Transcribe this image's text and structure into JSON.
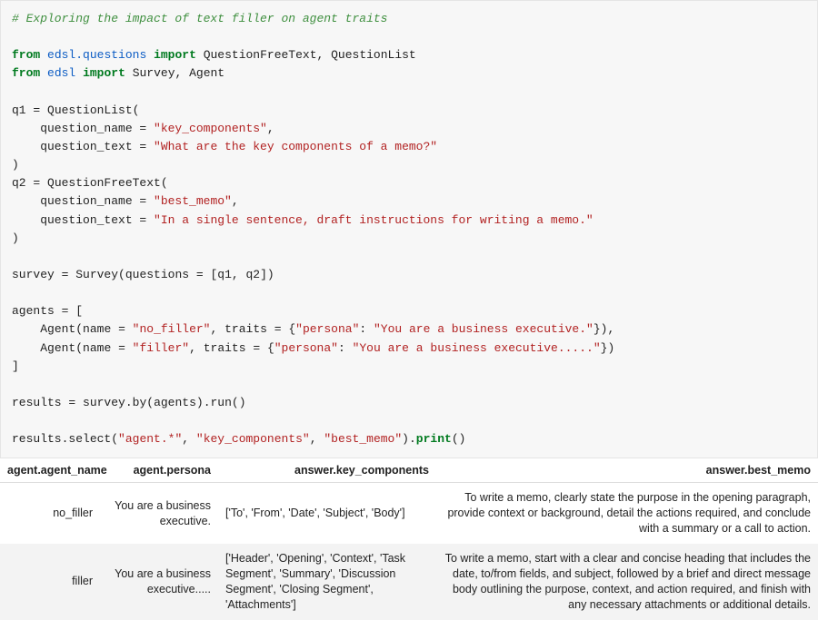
{
  "code": {
    "comment": "# Exploring the impact of text filler on agent traits",
    "kw_from": "from",
    "kw_import": "import",
    "mod1": "edsl.questions",
    "imp1": "QuestionFreeText, QuestionList",
    "mod2": "edsl",
    "imp2": "Survey, Agent",
    "q1_var": "q1",
    "eq": " = ",
    "QList": "QuestionList",
    "QFree": "QuestionFreeText",
    "qname_lbl": "    question_name",
    "qtext_lbl": "    question_text",
    "q1_name": "\"key_components\"",
    "q1_text": "\"What are the key components of a memo?\"",
    "q2_var": "q2",
    "q2_name": "\"best_memo\"",
    "q2_text": "\"In a single sentence, draft instructions for writing a memo.\"",
    "survey_var": "survey",
    "Survey": "Survey",
    "questions_kw": "questions",
    "q_list": "[q1, q2]",
    "agents_var": "agents",
    "open_bracket": " = [",
    "Agent": "Agent",
    "name_kw": "name",
    "traits_kw": "traits",
    "persona_key": "\"persona\"",
    "a1_name": "\"no_filler\"",
    "a1_persona": "\"You are a business executive.\"",
    "a2_name": "\"filler\"",
    "a2_persona": "\"You are a business executive.....\"",
    "close_bracket": "]",
    "results_var": "results",
    "by": "by",
    "run": "run",
    "select": "select",
    "print": "print",
    "sel1": "\"agent.*\"",
    "sel2": "\"key_components\"",
    "sel3": "\"best_memo\"",
    "comma": ",",
    "dot": ".",
    "lp": "(",
    "rp": ")",
    "lb": "{",
    "rb": "}",
    "colon": ": "
  },
  "table": {
    "headers": {
      "agent_name": "agent.agent_name",
      "persona": "agent.persona",
      "key_components": "answer.key_components",
      "best_memo": "answer.best_memo"
    },
    "rows": [
      {
        "name": "no_filler",
        "persona": "You are a business executive.",
        "key_components": "['To', 'From', 'Date', 'Subject', 'Body']",
        "best_memo": "To write a memo, clearly state the purpose in the opening paragraph, provide context or background, detail the actions required, and conclude with a summary or a call to action."
      },
      {
        "name": "filler",
        "persona": "You are a business executive.....",
        "key_components": "['Header', 'Opening', 'Context', 'Task Segment', 'Summary', 'Discussion Segment', 'Closing Segment', 'Attachments']",
        "best_memo": "To write a memo, start with a clear and concise heading that includes the date, to/from fields, and subject, followed by a brief and direct message body outlining the purpose, context, and action required, and finish with any necessary attachments or additional details."
      }
    ]
  }
}
